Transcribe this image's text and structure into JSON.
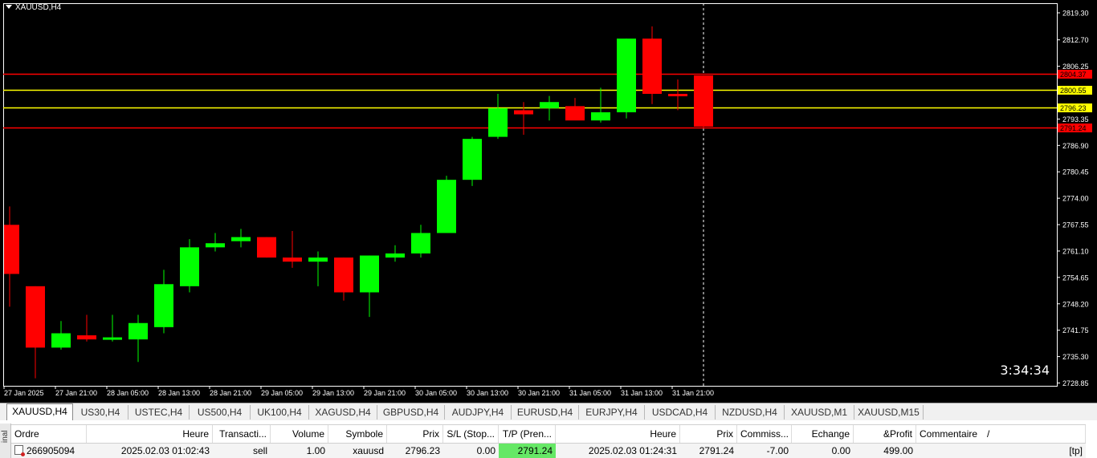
{
  "chart": {
    "title": "XAUUSD,H4",
    "timer": "3:34:34",
    "colors": {
      "bull": "#00ff00",
      "bear": "#ff0000",
      "background": "#000000",
      "axis": "#ffffff",
      "sl_tp_line": "#ff0000",
      "entry_line": "#ffff00"
    }
  },
  "chart_data": {
    "type": "candlestick",
    "ylim": [
      2726.0,
      2822.0
    ],
    "y_ticks": [
      "2819.30",
      "2812.70",
      "2806.25",
      "2800.55",
      "2793.35",
      "2786.90",
      "2780.45",
      "2774.00",
      "2767.55",
      "2761.10",
      "2754.65",
      "2748.20",
      "2741.75",
      "2735.30",
      "2728.85"
    ],
    "x_labels": [
      "27 Jan 2025",
      "27 Jan 21:00",
      "28 Jan 05:00",
      "28 Jan 13:00",
      "28 Jan 21:00",
      "29 Jan 05:00",
      "29 Jan 13:00",
      "29 Jan 21:00",
      "30 Jan 05:00",
      "30 Jan 13:00",
      "30 Jan 21:00",
      "31 Jan 05:00",
      "31 Jan 13:00",
      "31 Jan 21:00"
    ],
    "candles": [
      {
        "o": 2767.5,
        "h": 2772.0,
        "l": 2747.5,
        "c": 2755.5
      },
      {
        "o": 2752.5,
        "h": 2752.5,
        "l": 2730.0,
        "c": 2737.5
      },
      {
        "o": 2737.5,
        "h": 2744.0,
        "l": 2737.0,
        "c": 2741.0
      },
      {
        "o": 2740.5,
        "h": 2745.5,
        "l": 2739.0,
        "c": 2739.5
      },
      {
        "o": 2739.5,
        "h": 2745.5,
        "l": 2739.0,
        "c": 2740.0
      },
      {
        "o": 2739.5,
        "h": 2745.5,
        "l": 2734.0,
        "c": 2743.5
      },
      {
        "o": 2742.5,
        "h": 2756.5,
        "l": 2741.0,
        "c": 2753.0
      },
      {
        "o": 2752.5,
        "h": 2764.0,
        "l": 2751.0,
        "c": 2762.0
      },
      {
        "o": 2762.0,
        "h": 2765.5,
        "l": 2761.0,
        "c": 2763.0
      },
      {
        "o": 2763.5,
        "h": 2766.5,
        "l": 2762.0,
        "c": 2764.5
      },
      {
        "o": 2764.5,
        "h": 2764.5,
        "l": 2759.5,
        "c": 2759.5
      },
      {
        "o": 2759.5,
        "h": 2766.0,
        "l": 2757.0,
        "c": 2758.5
      },
      {
        "o": 2758.5,
        "h": 2761.0,
        "l": 2752.5,
        "c": 2759.5
      },
      {
        "o": 2759.5,
        "h": 2759.5,
        "l": 2749.0,
        "c": 2751.0
      },
      {
        "o": 2751.0,
        "h": 2760.0,
        "l": 2745.0,
        "c": 2760.0
      },
      {
        "o": 2759.5,
        "h": 2762.5,
        "l": 2758.5,
        "c": 2760.5
      },
      {
        "o": 2760.5,
        "h": 2767.5,
        "l": 2759.5,
        "c": 2765.5
      },
      {
        "o": 2765.5,
        "h": 2779.5,
        "l": 2765.5,
        "c": 2778.5
      },
      {
        "o": 2778.5,
        "h": 2789.0,
        "l": 2777.0,
        "c": 2788.5
      },
      {
        "o": 2789.0,
        "h": 2799.5,
        "l": 2788.5,
        "c": 2796.0
      },
      {
        "o": 2795.5,
        "h": 2797.5,
        "l": 2789.5,
        "c": 2794.5
      },
      {
        "o": 2796.0,
        "h": 2799.0,
        "l": 2793.0,
        "c": 2797.5
      },
      {
        "o": 2796.5,
        "h": 2798.5,
        "l": 2793.5,
        "c": 2793.0
      },
      {
        "o": 2793.0,
        "h": 2801.0,
        "l": 2792.5,
        "c": 2795.0
      },
      {
        "o": 2795.0,
        "h": 2813.0,
        "l": 2793.5,
        "c": 2813.0
      },
      {
        "o": 2813.0,
        "h": 2816.0,
        "l": 2797.0,
        "c": 2799.5
      },
      {
        "o": 2799.5,
        "h": 2803.0,
        "l": 2795.5,
        "c": 2799.0
      },
      {
        "o": 2804.0,
        "h": 2804.0,
        "l": 2791.0,
        "c": 2791.5
      }
    ],
    "hlines": [
      {
        "value": 2804.37,
        "label": "2804.37",
        "color": "#ff0000"
      },
      {
        "value": 2800.55,
        "label": "2800.55",
        "color": "#ffff00"
      },
      {
        "value": 2796.23,
        "label": "2796.23",
        "color": "#ffff00"
      },
      {
        "value": 2791.24,
        "label": "2791.24",
        "color": "#ff0000"
      }
    ]
  },
  "tabs": [
    "XAUUSD,H4",
    "US30,H4",
    "USTEC,H4",
    "US500,H4",
    "UK100,H4",
    "XAGUSD,H4",
    "GBPUSD,H4",
    "AUDJPY,H4",
    "EURUSD,H4",
    "EURJPY,H4",
    "USDCAD,H4",
    "NZDUSD,H4",
    "XAUUSD,M1",
    "XAUUSD,M15"
  ],
  "terminal": {
    "side_label": "inal",
    "columns": [
      "Ordre",
      "Heure",
      "Transacti...",
      "Volume",
      "Symbole",
      "Prix",
      "S/L (Stop...",
      "T/P (Pren...",
      "Heure",
      "Prix",
      "Commiss...",
      "Echange",
      "&Profit",
      "Commentaire"
    ],
    "sort_marker": "/",
    "row": [
      "266905094",
      "2025.02.03 01:02:43",
      "sell",
      "1.00",
      "xauusd",
      "2796.23",
      "0.00",
      "2791.24",
      "2025.02.03 01:24:31",
      "2791.24",
      "-7.00",
      "0.00",
      "499.00",
      "[tp]"
    ]
  }
}
